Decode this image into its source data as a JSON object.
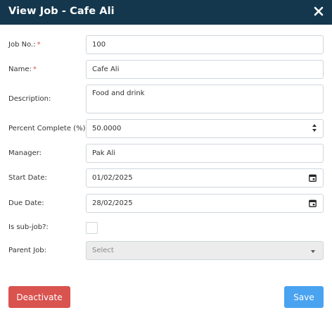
{
  "dialog": {
    "title": "View Job - Cafe Ali",
    "close_icon": "close-icon"
  },
  "form": {
    "job_no": {
      "label": "Job No.:",
      "required": "*",
      "value": "100"
    },
    "name": {
      "label": "Name:",
      "required": "*",
      "value": "Cafe Ali"
    },
    "description": {
      "label": "Description:",
      "value": "Food and drink"
    },
    "percent_complete": {
      "label": "Percent Complete (%):",
      "value": "50.0000"
    },
    "manager": {
      "label": "Manager:",
      "value": "Pak Ali"
    },
    "start_date": {
      "label": "Start Date:",
      "value": "01/02/2025",
      "icon": "calendar-icon"
    },
    "due_date": {
      "label": "Due Date:",
      "value": "28/02/2025",
      "icon": "calendar-icon"
    },
    "is_sub_job": {
      "label": "Is sub-job?:",
      "checked": false
    },
    "parent_job": {
      "label": "Parent Job:",
      "placeholder": "Select",
      "disabled": true
    }
  },
  "buttons": {
    "deactivate": "Deactivate",
    "save": "Save"
  },
  "colors": {
    "titlebar": "#14374d",
    "deactivate": "#d9534f",
    "save": "#4aa3f0",
    "required": "#d9534f"
  }
}
